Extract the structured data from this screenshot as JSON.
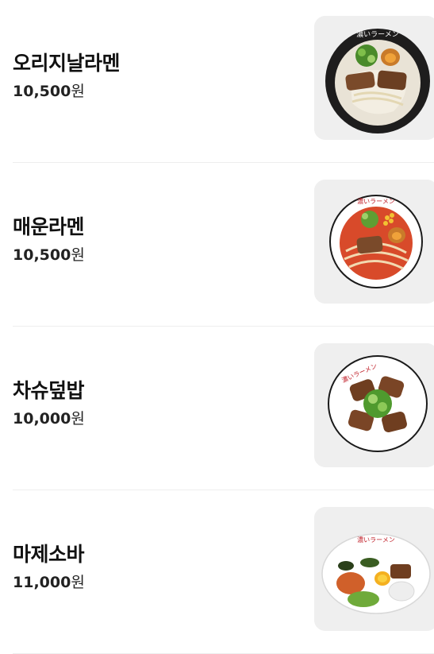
{
  "menu": {
    "items": [
      {
        "name": "오리지날라멘",
        "price": "10,500",
        "unit": "원",
        "image": "ramen-tonkotsu-bowl"
      },
      {
        "name": "매운라멘",
        "price": "10,500",
        "unit": "원",
        "image": "spicy-ramen-bowl"
      },
      {
        "name": "차슈덮밥",
        "price": "10,000",
        "unit": "원",
        "image": "chashu-rice-bowl"
      },
      {
        "name": "마제소바",
        "price": "11,000",
        "unit": "원",
        "image": "mazesoba-bowl"
      }
    ],
    "bowl_brand": "濃いラーメン"
  }
}
